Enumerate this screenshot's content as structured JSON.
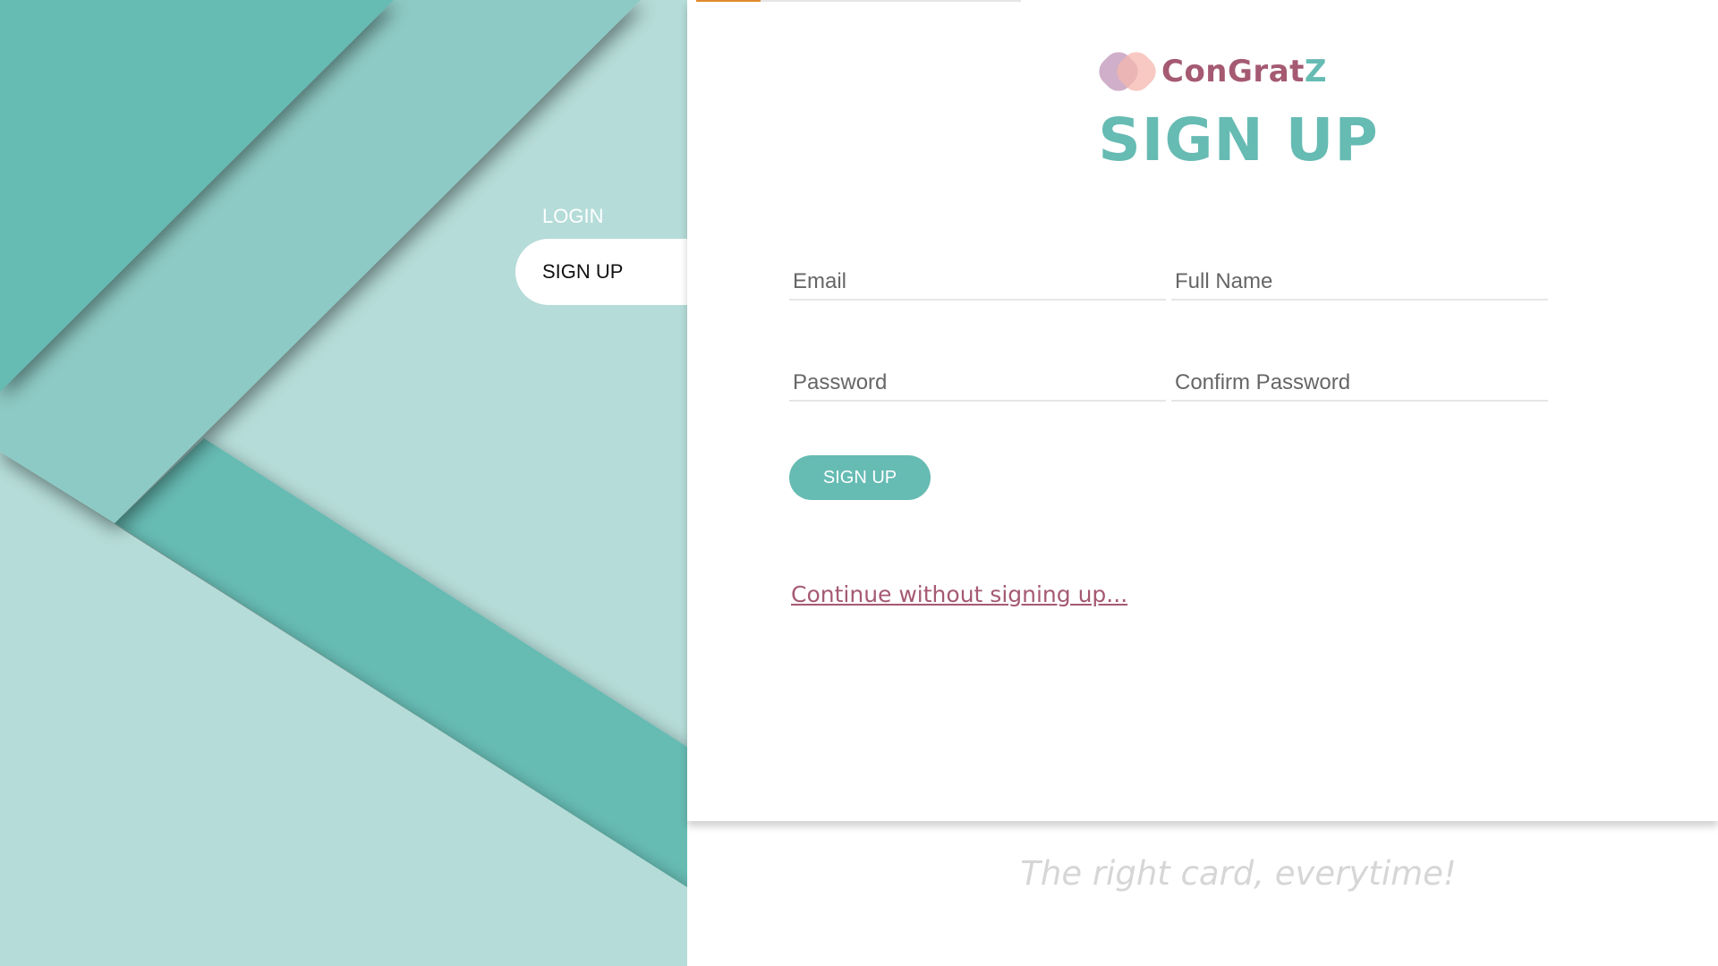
{
  "brand": {
    "name_main": "ConGrat",
    "name_accent": "Z"
  },
  "page": {
    "title": "SIGN UP",
    "tagline": "The right card, everytime!"
  },
  "nav": {
    "login_label": "LOGIN",
    "signup_label": "SIGN UP",
    "active": "SIGN UP"
  },
  "form": {
    "email_placeholder": "Email",
    "fullname_placeholder": "Full Name",
    "password_placeholder": "Password",
    "confirm_password_placeholder": "Confirm Password",
    "email_value": "",
    "fullname_value": "",
    "password_value": "",
    "confirm_password_value": "",
    "submit_label": "SIGN UP"
  },
  "links": {
    "skip_label": "Continue without signing up..."
  },
  "colors": {
    "teal": "#66bbb3",
    "teal_light": "#b5dcd8",
    "teal_mid": "#8ecac5",
    "plum": "#a55a72",
    "progress_accent": "#e08a2e"
  }
}
